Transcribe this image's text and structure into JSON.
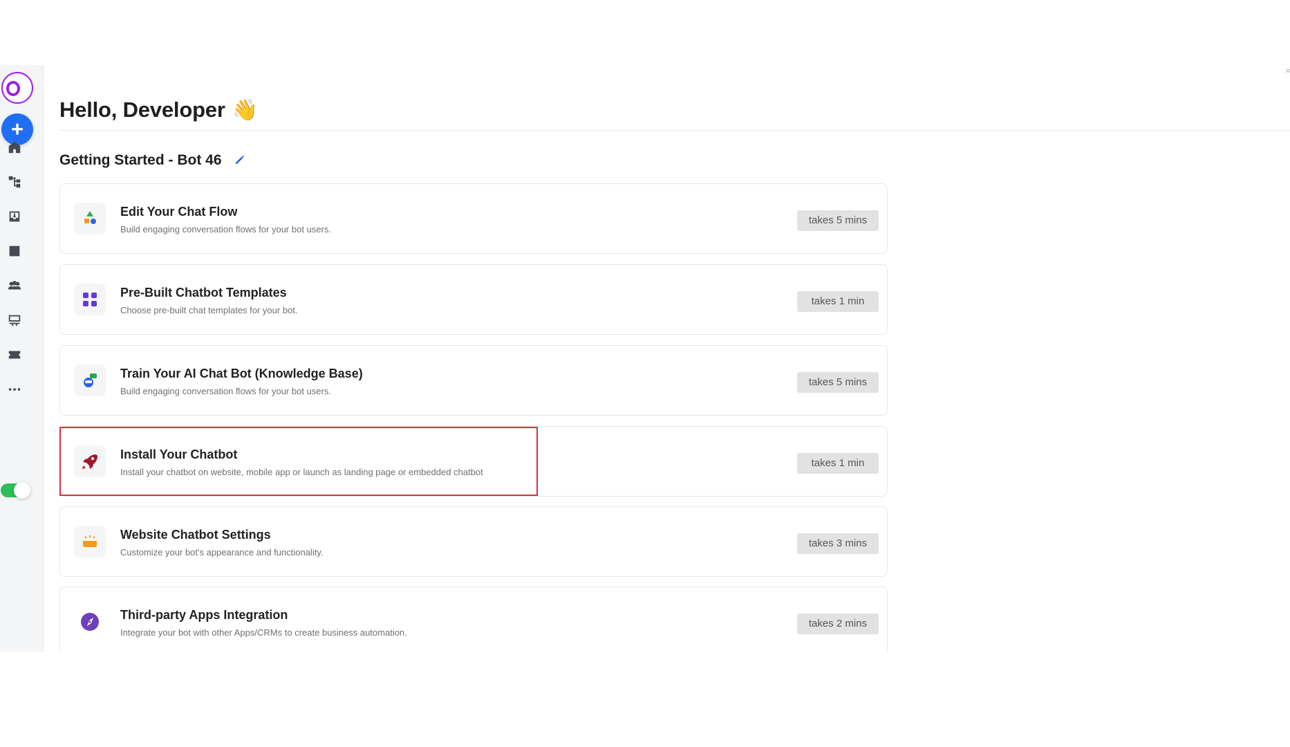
{
  "header": {
    "greeting": "Hello, Developer",
    "wave_emoji": "👋"
  },
  "section": {
    "title": "Getting Started - Bot 46"
  },
  "cards": [
    {
      "title": "Edit Your Chat Flow",
      "description": "Build engaging conversation flows for your bot users.",
      "duration": "takes 5 mins",
      "icon": "shapes-icon"
    },
    {
      "title": "Pre-Built Chatbot Templates",
      "description": "Choose pre-built chat templates for your bot.",
      "duration": "takes 1 min",
      "icon": "grid-icon"
    },
    {
      "title": "Train Your AI Chat Bot (Knowledge Base)",
      "description": "Build engaging conversation flows for your bot users.",
      "duration": "takes 5 mins",
      "icon": "ai-bot-icon"
    },
    {
      "title": "Install Your Chatbot",
      "description": "Install your chatbot on website, mobile app or launch as landing page or embedded chatbot",
      "duration": "takes 1 min",
      "icon": "rocket-icon"
    },
    {
      "title": "Website Chatbot Settings",
      "description": "Customize your bot's appearance and functionality.",
      "duration": "takes 3 mins",
      "icon": "settings-widget-icon"
    },
    {
      "title": "Third-party Apps Integration",
      "description": "Integrate your bot with other Apps/CRMs to create business automation.",
      "duration": "takes 2 mins",
      "icon": "compass-icon"
    }
  ],
  "colors": {
    "primary_blue": "#1f6ff2",
    "logo_purple": "#9d1ee8",
    "toggle_green": "#2fbe58",
    "highlight_red": "#d6323b"
  }
}
